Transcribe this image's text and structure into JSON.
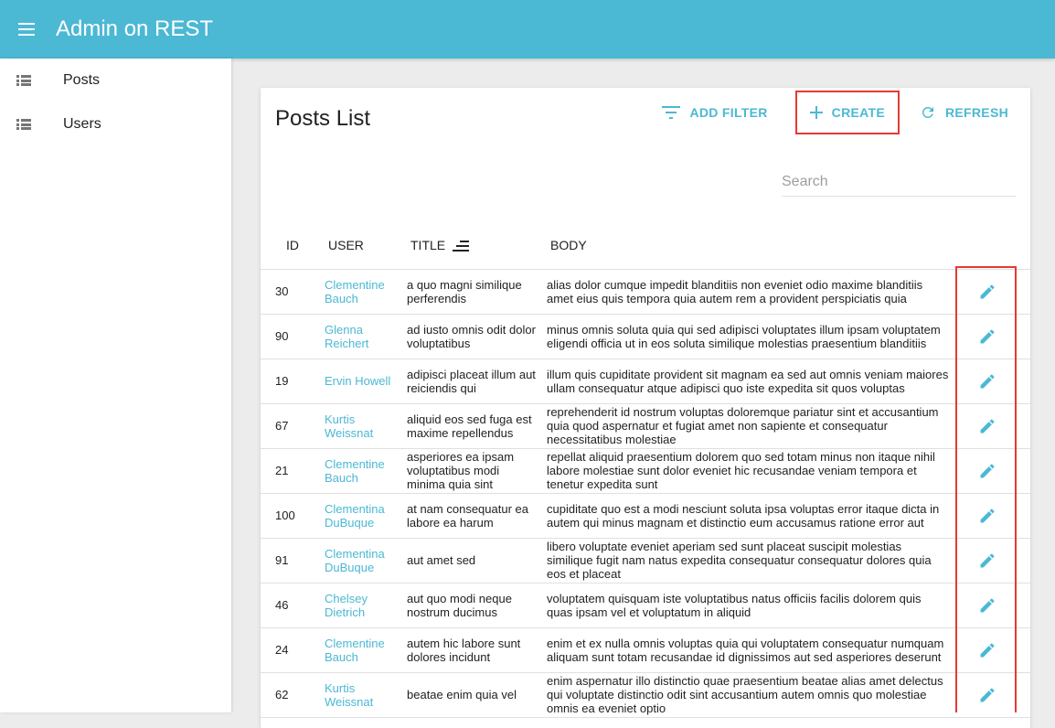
{
  "app": {
    "title": "Admin on REST"
  },
  "sidebar": {
    "items": [
      {
        "label": "Posts",
        "icon": "list-icon"
      },
      {
        "label": "Users",
        "icon": "list-icon"
      }
    ]
  },
  "list": {
    "title": "Posts List",
    "actions": {
      "add_filter": "ADD FILTER",
      "create": "CREATE",
      "refresh": "REFRESH"
    },
    "search": {
      "placeholder": "Search",
      "value": ""
    },
    "columns": {
      "id": "ID",
      "user": "USER",
      "title": "TITLE",
      "body": "BODY"
    },
    "sort_column": "title",
    "rows": [
      {
        "id": "30",
        "user": "Clementine Bauch",
        "title": "a quo magni similique perferendis",
        "body": "alias dolor cumque impedit blanditiis non eveniet odio maxime blanditiis amet eius quis tempora quia autem rem a provident perspiciatis quia"
      },
      {
        "id": "90",
        "user": "Glenna Reichert",
        "title": "ad iusto omnis odit dolor voluptatibus",
        "body": "minus omnis soluta quia qui sed adipisci voluptates illum ipsam voluptatem eligendi officia ut in eos soluta similique molestias praesentium blanditiis"
      },
      {
        "id": "19",
        "user": "Ervin Howell",
        "title": "adipisci placeat illum aut reiciendis qui",
        "body": "illum quis cupiditate provident sit magnam ea sed aut omnis veniam maiores ullam consequatur atque adipisci quo iste expedita sit quos voluptas"
      },
      {
        "id": "67",
        "user": "Kurtis Weissnat",
        "title": "aliquid eos sed fuga est maxime repellendus",
        "body": "reprehenderit id nostrum voluptas doloremque pariatur sint et accusantium quia quod aspernatur et fugiat amet non sapiente et consequatur necessitatibus molestiae"
      },
      {
        "id": "21",
        "user": "Clementine Bauch",
        "title": "asperiores ea ipsam voluptatibus modi minima quia sint",
        "body": "repellat aliquid praesentium dolorem quo sed totam minus non itaque nihil labore molestiae sunt dolor eveniet hic recusandae veniam tempora et tenetur expedita sunt"
      },
      {
        "id": "100",
        "user": "Clementina DuBuque",
        "title": "at nam consequatur ea labore ea harum",
        "body": "cupiditate quo est a modi nesciunt soluta ipsa voluptas error itaque dicta in autem qui minus magnam et distinctio eum accusamus ratione error aut"
      },
      {
        "id": "91",
        "user": "Clementina DuBuque",
        "title": "aut amet sed",
        "body": "libero voluptate eveniet aperiam sed sunt placeat suscipit molestias similique fugit nam natus expedita consequatur consequatur dolores quia eos et placeat"
      },
      {
        "id": "46",
        "user": "Chelsey Dietrich",
        "title": "aut quo modi neque nostrum ducimus",
        "body": "voluptatem quisquam iste voluptatibus natus officiis facilis dolorem quis quas ipsam vel et voluptatum in aliquid"
      },
      {
        "id": "24",
        "user": "Clementine Bauch",
        "title": "autem hic labore sunt dolores incidunt",
        "body": "enim et ex nulla omnis voluptas quia qui voluptatem consequatur numquam aliquam sunt totam recusandae id dignissimos aut sed asperiores deserunt"
      },
      {
        "id": "62",
        "user": "Kurtis Weissnat",
        "title": "beatae enim quia vel",
        "body": "enim aspernatur illo distinctio quae praesentium beatae alias amet delectus qui voluptate distinctio odit sint accusantium autem omnis quo molestiae omnis ea eveniet optio"
      }
    ]
  },
  "colors": {
    "accent": "#4bb8d4",
    "highlight": "#e53935"
  }
}
